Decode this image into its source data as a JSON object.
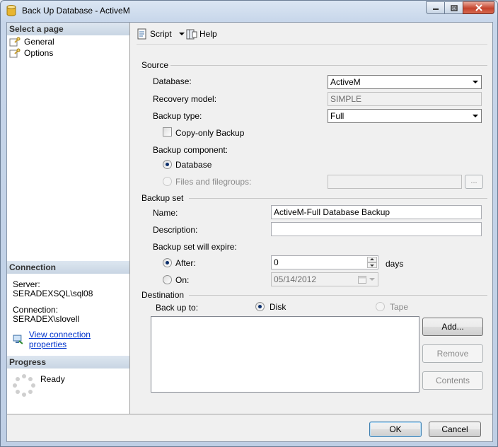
{
  "window": {
    "title": "Back Up Database - ActiveM"
  },
  "left_pane": {
    "select_page_header": "Select a page",
    "pages": [
      {
        "label": "General",
        "icon": "page-settings-icon"
      },
      {
        "label": "Options",
        "icon": "page-settings-icon"
      }
    ],
    "connection_header": "Connection",
    "server_label": "Server:",
    "server_value": "SERADEXSQL\\sql08",
    "connection_label": "Connection:",
    "connection_value": "SERADEX\\slovell",
    "view_connection_link": "View connection properties",
    "progress_header": "Progress",
    "progress_status": "Ready"
  },
  "toolbar": {
    "script_label": "Script",
    "help_label": "Help"
  },
  "source": {
    "group_label": "Source",
    "database_label": "Database:",
    "database_value": "ActiveM",
    "recovery_model_label": "Recovery model:",
    "recovery_model_value": "SIMPLE",
    "backup_type_label": "Backup type:",
    "backup_type_value": "Full",
    "copy_only_label": "Copy-only Backup",
    "backup_component_label": "Backup component:",
    "component_database_label": "Database",
    "component_files_label": "Files and filegroups:",
    "browse_label": "..."
  },
  "backup_set": {
    "group_label": "Backup set",
    "name_label": "Name:",
    "name_value": "ActiveM-Full Database Backup",
    "description_label": "Description:",
    "description_value": "",
    "expire_label": "Backup set will expire:",
    "after_label": "After:",
    "after_value": "0",
    "days_label": "days",
    "on_label": "On:",
    "on_value": "05/14/2012"
  },
  "destination": {
    "group_label": "Destination",
    "back_up_to_label": "Back up to:",
    "disk_label": "Disk",
    "tape_label": "Tape",
    "add_label": "Add...",
    "remove_label": "Remove",
    "contents_label": "Contents"
  },
  "footer": {
    "ok_label": "OK",
    "cancel_label": "Cancel"
  },
  "colors": {
    "link": "#0033cc",
    "header_bg": "#c8d5e3",
    "close_button": "#c4432c"
  }
}
